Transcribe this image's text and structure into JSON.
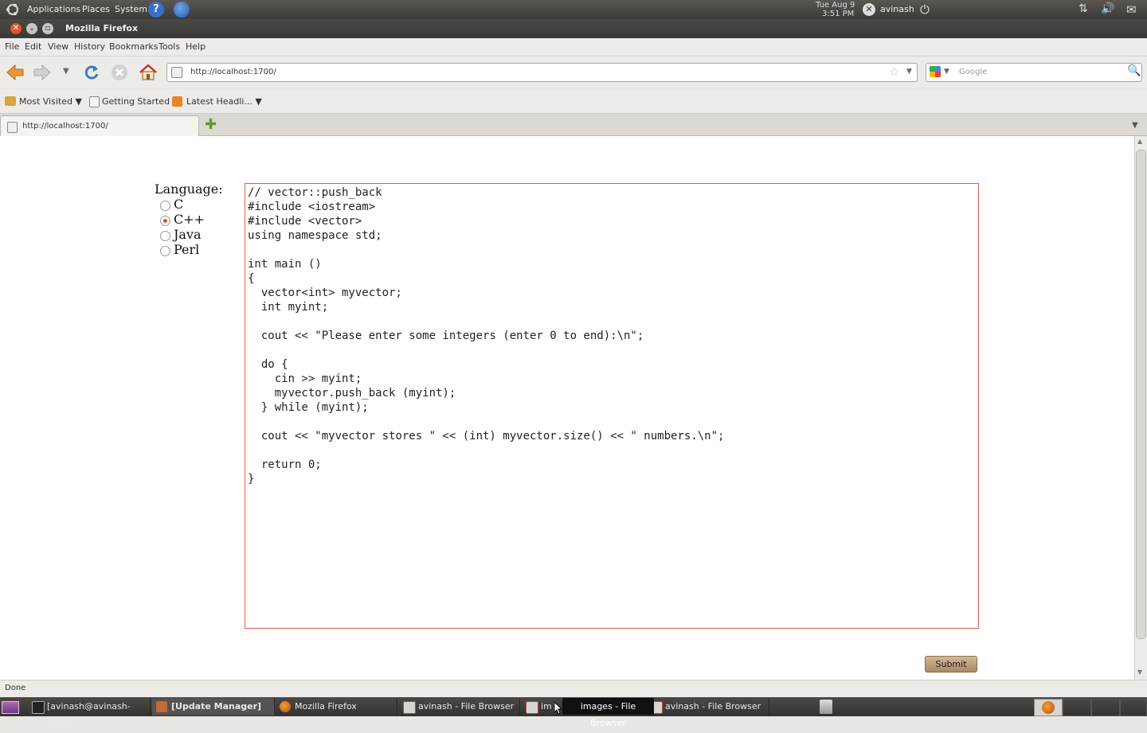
{
  "top_panel": {
    "menus": [
      "Applications",
      "Places",
      "System"
    ],
    "date": "Tue Aug  9",
    "time": "3:51 PM",
    "user": "avinash"
  },
  "window": {
    "title": "Mozilla Firefox"
  },
  "menubar": [
    "File",
    "Edit",
    "View",
    "History",
    "Bookmarks",
    "Tools",
    "Help"
  ],
  "navbar": {
    "url": "http://localhost:1700/",
    "search_placeholder": "Google"
  },
  "bookmarks": [
    {
      "label": "Most Visited ▼"
    },
    {
      "label": "Getting Started"
    },
    {
      "label": "Latest Headli... ▼"
    }
  ],
  "tabs": [
    {
      "label": "http://localhost:1700/"
    }
  ],
  "form": {
    "language_label": "Language:",
    "languages": [
      {
        "label": "C",
        "checked": false
      },
      {
        "label": "C++",
        "checked": true
      },
      {
        "label": "Java",
        "checked": false
      },
      {
        "label": "Perl",
        "checked": false
      }
    ],
    "code": "// vector::push_back\n#include <iostream>\n#include <vector>\nusing namespace std;\n\nint main ()\n{\n  vector<int> myvector;\n  int myint;\n\n  cout << \"Please enter some integers (enter 0 to end):\\n\";\n\n  do {\n    cin >> myint;\n    myvector.push_back (myint);\n  } while (myint);\n\n  cout << \"myvector stores \" << (int) myvector.size() << \" numbers.\\n\";\n\n  return 0;\n}",
    "submit_label": "Submit"
  },
  "statusbar": {
    "text": "Done"
  },
  "taskbar": {
    "items": [
      "[avinash@avinash-lapt...",
      "[Update Manager]",
      "Mozilla Firefox",
      "avinash - File Browser",
      "im",
      "avinash - File Browser"
    ],
    "tooltip": "images - File Browser"
  },
  "colors": {
    "accent": "#e04a2a",
    "editor_border": "#d9604d"
  }
}
